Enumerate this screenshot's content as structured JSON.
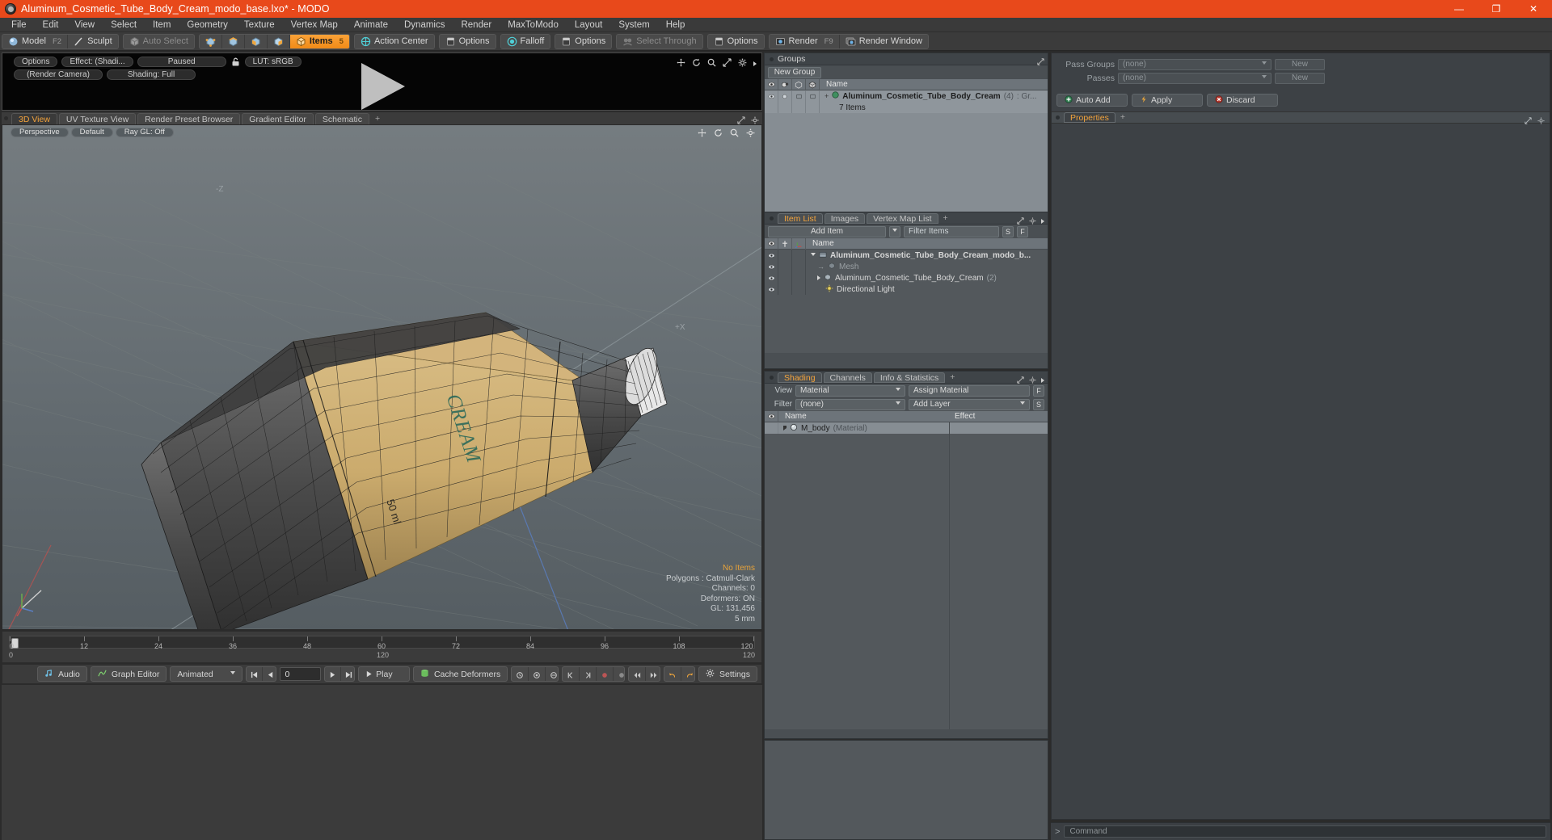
{
  "window": {
    "title": "Aluminum_Cosmetic_Tube_Body_Cream_modo_base.lxo* - MODO",
    "minimize": "—",
    "maximize": "❐",
    "close": "✕"
  },
  "menubar": {
    "items": [
      "File",
      "Edit",
      "View",
      "Select",
      "Item",
      "Geometry",
      "Texture",
      "Vertex Map",
      "Animate",
      "Dynamics",
      "Render",
      "MaxToModo",
      "Layout",
      "System",
      "Help"
    ]
  },
  "toolbar": {
    "mode_model": "Model",
    "mode_model_hotkey": "F2",
    "mode_sculpt": "Sculpt",
    "auto_select": "Auto Select",
    "items_label": "Items",
    "items_hotkey": "5",
    "action_center": "Action Center",
    "options1": "Options",
    "falloff": "Falloff",
    "options2": "Options",
    "select_through": "Select Through",
    "options3": "Options",
    "render": "Render",
    "render_hotkey": "F9",
    "render_window": "Render Window"
  },
  "render_preview": {
    "options": "Options",
    "effect": "Effect: (Shadi...",
    "paused": "Paused",
    "lut": "LUT: sRGB",
    "camera": "(Render Camera)",
    "shading": "Shading: Full"
  },
  "viewport_tabs": {
    "tabs": [
      "3D View",
      "UV Texture View",
      "Render Preset Browser",
      "Gradient Editor",
      "Schematic"
    ],
    "active": "3D View",
    "plus": "+"
  },
  "viewport": {
    "perspective": "Perspective",
    "shading_preset": "Default",
    "raygl": "Ray GL: Off",
    "axis_labels": {
      "neg_z": "-Z",
      "pos_x": "+X"
    },
    "stats": {
      "no_items": "No Items",
      "polygons": "Polygons : Catmull-Clark",
      "channels": "Channels: 0",
      "deformers": "Deformers: ON",
      "gl": "GL: 131,456",
      "size": "5 mm"
    }
  },
  "timeline": {
    "ticks": [
      "0",
      "12",
      "24",
      "36",
      "48",
      "60",
      "72",
      "84",
      "96",
      "108",
      "120"
    ],
    "center_label": "120",
    "start_label": "0",
    "end_label": "120"
  },
  "bottombar": {
    "audio": "Audio",
    "graph_editor": "Graph Editor",
    "animated": "Animated",
    "frame_value": "0",
    "play": "Play",
    "cache_deformers": "Cache Deformers",
    "settings": "Settings"
  },
  "groups_panel": {
    "title": "Groups",
    "new_group": "New Group",
    "column_name": "Name",
    "item_name": "Aluminum_Cosmetic_Tube_Body_Cream",
    "item_count": "(4)",
    "item_suffix": ": Gr...",
    "item_sub": "7 Items"
  },
  "item_list_panel": {
    "tabs": [
      "Item List",
      "Images",
      "Vertex Map List"
    ],
    "active": "Item List",
    "plus": "+",
    "add_item": "Add Item",
    "filter_placeholder": "Filter Items",
    "btn_s": "S",
    "btn_f": "F",
    "column_name": "Name",
    "rows": [
      {
        "name": "Aluminum_Cosmetic_Tube_Body_Cream_modo_b...",
        "indent": 0,
        "bold": true,
        "kind": "scene"
      },
      {
        "name": "Mesh",
        "indent": 1,
        "bold": false,
        "kind": "mesh",
        "dim": true
      },
      {
        "name": "Aluminum_Cosmetic_Tube_Body_Cream",
        "indent": 1,
        "bold": false,
        "kind": "mesh",
        "count": "(2)"
      },
      {
        "name": "Directional Light",
        "indent": 1,
        "bold": false,
        "kind": "light"
      }
    ]
  },
  "shading_panel": {
    "tabs": [
      "Shading",
      "Channels",
      "Info & Statistics"
    ],
    "active": "Shading",
    "plus": "+",
    "view_label": "View",
    "view_value": "Material",
    "assign_material": "Assign Material",
    "btn_f": "F",
    "filter_label": "Filter",
    "filter_value": "(none)",
    "add_layer": "Add Layer",
    "btn_s": "S",
    "column_name": "Name",
    "column_effect": "Effect",
    "rows": [
      {
        "name": "M_body",
        "type": "(Material)"
      }
    ]
  },
  "right_panel": {
    "pass_groups_label": "Pass Groups",
    "pass_groups_value": "(none)",
    "pass_groups_new": "New",
    "passes_label": "Passes",
    "passes_value": "(none)",
    "passes_new": "New",
    "auto_add": "Auto Add",
    "apply": "Apply",
    "discard": "Discard",
    "properties_tab": "Properties",
    "properties_plus": "+",
    "command_placeholder": "Command",
    "command_prompt": ">"
  },
  "colors": {
    "title_bar": "#e8491b",
    "accent": "#f3a33c",
    "panel": "#4a4f53",
    "list": "#868d93",
    "viewport_top": "#6f767a"
  }
}
